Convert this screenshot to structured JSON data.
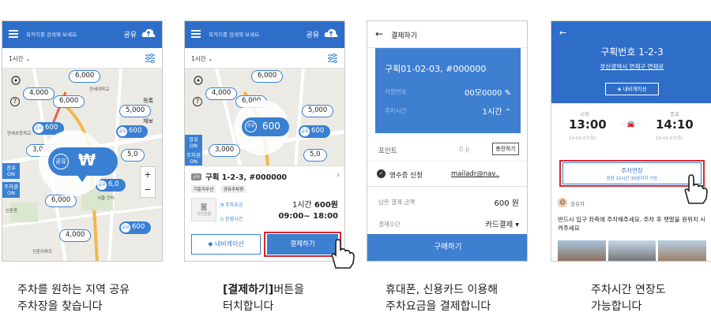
{
  "screens": {
    "map": {
      "search_placeholder": "목적지를 검색해 보세요.",
      "share_label": "공유",
      "time_select": "1시간",
      "markers": [
        "6,000",
        "4,000",
        "6,000",
        "5,000",
        "600",
        "3,000",
        "600",
        "6,000",
        "4,000",
        "600",
        "5,0",
        "6,0"
      ],
      "featured_label": "공유",
      "featured_price": "₩",
      "side_tag_1": "공유 ON",
      "side_tag_2": "주차권 ON",
      "map_labels": [
        "목록",
        "제보",
        "연세초등학교",
        "연세대학교",
        "서울 인터",
        "신촌동",
        "신촌아파트"
      ]
    },
    "detail": {
      "search_placeholder": "목적지를 검색해 보세요.",
      "share_label": "공유",
      "time_select": "1시간",
      "featured_label": "공유",
      "featured_price": "600",
      "markers": [
        "6,000",
        "4,000",
        "6,000",
        "5,000",
        "600",
        "3,000",
        "3,000",
        "5,0"
      ],
      "side_tag_1": "공유 ON",
      "side_tag_2": "주차권 ON",
      "lot_tag": "공유",
      "lot_title": "구획 1-2-3, #000000",
      "chip_1": "기준자우선",
      "chip_2": "공유주차장",
      "fee_label": "주차요금",
      "fee_value_prefix": "1시간",
      "fee_value": "600원",
      "hours_label": "운영시간",
      "hours_value": "09:00~ 18:00",
      "nav_button": "내비게이션",
      "pay_button": "결제하기",
      "photo_label": "사진없음"
    },
    "payment": {
      "header_title": "결제하기",
      "lot_id": "구획01-02-03, #000000",
      "car_label": "차량번호",
      "car_value": "00모0000",
      "time_label": "주차시간",
      "time_value": "1시간",
      "point_label": "포인트",
      "point_value": "0 p",
      "charge_button": "충전하기",
      "receipt_label": "영수증 신청",
      "receipt_email": "mailadr@nav..",
      "remaining_label": "남은 결제 금액",
      "remaining_value": "600 원",
      "method_label": "결제수단",
      "method_value": "카드결제",
      "buy_button": "구매하기"
    },
    "extend": {
      "lot_title": "구획번호 1-2-3",
      "address": "부산광역시 연제구 연제로",
      "nav_button": "내비게이션",
      "start_label": "시작",
      "start_time": "13:00",
      "start_date": "19-02-07(화)",
      "end_label": "종료",
      "end_time": "14:10",
      "end_date": "19-02-07(화)",
      "extend_button": "주차연장",
      "extend_note": "최장 10시간 30분까지 가능",
      "sharer_label": "공유자",
      "sharer_message": "반드시 입구 좌측에 주차해주세요. 주차 후 팻말을 원위치 시켜주세요"
    }
  },
  "captions": {
    "c1": [
      "주차를 원하는 지역 공유",
      "주차장을 찾습니다"
    ],
    "c2_bold": "[결제하기]",
    "c2_rest": "버튼을",
    "c2_line2": "터치합니다",
    "c3": [
      "휴대폰, 신용카드 이용해",
      "주차요금을 결제합니다"
    ],
    "c4": [
      "주차시간 연장도",
      "가능합니다"
    ]
  },
  "colors": {
    "primary": "#2e6ec9",
    "card": "#3e7fd0",
    "highlight": "#d9272e",
    "map_bg": "#eceae5"
  }
}
